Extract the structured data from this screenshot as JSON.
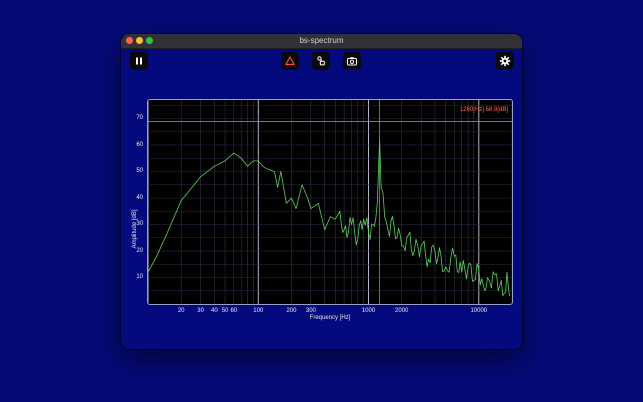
{
  "window": {
    "title": "bs-spectrum"
  },
  "toolbar": {
    "pause_icon": "pause-icon",
    "triangle_icon": "triangle-warning-icon",
    "pointer_icon": "pointer-icon",
    "camera_icon": "camera-icon",
    "settings_icon": "gear-icon"
  },
  "colors": {
    "background": "#050a78",
    "trace": "#5ccf5c",
    "marker": "#ff5a4a",
    "grid": "#3a3f5a"
  },
  "chart_data": {
    "type": "line",
    "xlabel": "Frequency [Hz]",
    "ylabel": "Amplitude [dB]",
    "xscale": "log",
    "xlim": [
      10,
      20000
    ],
    "ylim": [
      0,
      77
    ],
    "xticks": [
      20,
      30,
      40,
      50,
      60,
      100,
      200,
      300,
      1000,
      2000,
      10000
    ],
    "xtick_labels": [
      "20",
      "30",
      "40",
      "50",
      "60",
      "100",
      "200",
      "300",
      "1000",
      "2000",
      "10000"
    ],
    "yticks": [
      10,
      20,
      30,
      40,
      50,
      60,
      70
    ],
    "yticks_labels": [
      "10",
      "20",
      "30",
      "40",
      "50",
      "60",
      "70"
    ],
    "marker": {
      "freq": 1260,
      "level": 68.9,
      "label": "1260[Hz]  68.9[dB]"
    },
    "series": [
      {
        "x": [
          10,
          12,
          15,
          20,
          30,
          40,
          50,
          60,
          65,
          70,
          80,
          90,
          100,
          110,
          120,
          140,
          150,
          160,
          180,
          200,
          220,
          250,
          280,
          300,
          350,
          400,
          450,
          500,
          550,
          600,
          700,
          800,
          900,
          1000,
          1100,
          1200,
          1260,
          1300,
          1400,
          1500,
          1700,
          2000,
          2300,
          2600,
          3000,
          3500,
          4000,
          5000,
          6000,
          7000,
          8000,
          9000,
          10000,
          11000,
          12000,
          13000,
          14000,
          15000,
          16000,
          17000,
          18000,
          19000
        ],
        "y": [
          12,
          18,
          27,
          39,
          48,
          52,
          54,
          57,
          56,
          55,
          52,
          54,
          54,
          52,
          51,
          50,
          44,
          50,
          38,
          40,
          36,
          45,
          40,
          36,
          38,
          28,
          33,
          32,
          35,
          28,
          30,
          25,
          32,
          27,
          30,
          38,
          62,
          44,
          33,
          28,
          30,
          22,
          26,
          20,
          22,
          17,
          20,
          14,
          18,
          12,
          14,
          9,
          13,
          7,
          10,
          6,
          11,
          5,
          9,
          4,
          12,
          3
        ]
      }
    ]
  }
}
